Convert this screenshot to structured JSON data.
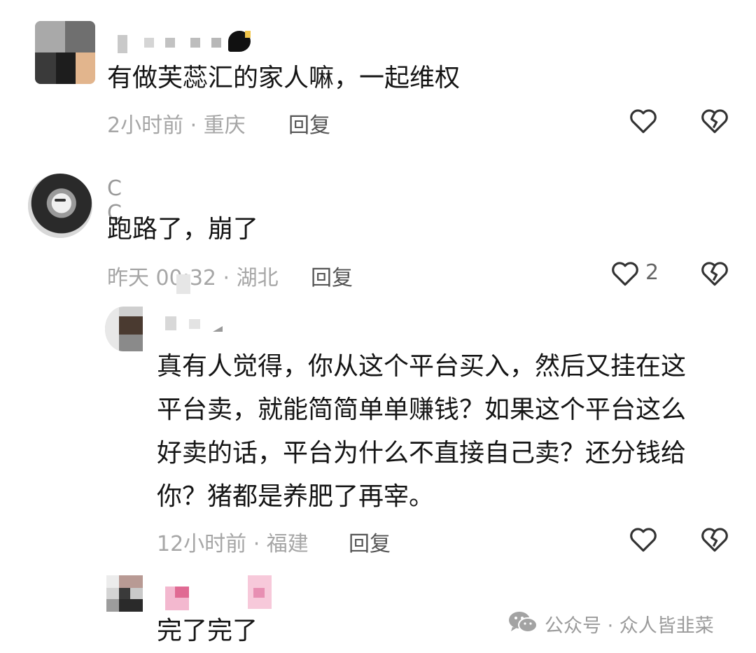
{
  "comments": [
    {
      "text": "有做芙蕊汇的家人嘛，一起维权",
      "time": "2小时前 · 重庆",
      "reply_label": "回复"
    },
    {
      "username": "C C",
      "text": "跑路了，崩了",
      "time": "昨天 00:32 · 湖北",
      "reply_label": "回复",
      "likes": "2"
    },
    {
      "lines": [
        "真有人觉得，你从这个平台买入，然后又挂在这",
        "平台卖，就能简简单单赚钱？如果这个平台这么",
        "好卖的话，平台为什么不直接自己卖？还分钱给",
        "你？猪都是养肥了再宰。"
      ],
      "time": "12小时前 · 福建",
      "reply_label": "回复"
    },
    {
      "text": "完了完了"
    }
  ],
  "watermark": "公众号 · 众人皆韭菜",
  "icons": [
    "heart-icon",
    "broken-heart-icon",
    "wechat-icon"
  ]
}
